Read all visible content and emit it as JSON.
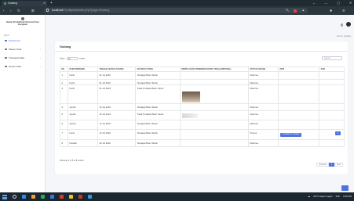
{
  "browser": {
    "tab_title": "Gudang",
    "new_tab_glyph": "+",
    "address_host": "localhost",
    "address_path": "/Ferdiipesa/index.php?page=Gudang",
    "window_controls": [
      "⌄",
      "—",
      "▢",
      "✕"
    ],
    "nav": [
      "‹",
      "›",
      "↻"
    ],
    "bookmark_glyph": "⊞"
  },
  "sidebar": {
    "brand_title": "Badan Pendaftaran Nasional Kota Bengkulu",
    "section_label": "MENU",
    "items": [
      {
        "label": "Dashboard",
        "icon": "dashboard-icon",
        "active": true
      },
      {
        "label": "Master Data",
        "icon": "folder-icon",
        "active": false,
        "chevron": "›"
      },
      {
        "label": "Transaksi Data",
        "icon": "exchange-icon",
        "active": false,
        "chevron": "›"
      },
      {
        "label": "Report Data",
        "icon": "report-icon",
        "active": false,
        "chevron": "›"
      }
    ]
  },
  "header": {
    "breadcrumb": "Home  /  Gudang"
  },
  "card": {
    "title": "Gudang",
    "show_label": "Show",
    "show_value": "10",
    "entries_label": "entries",
    "search_placeholder": "Search:",
    "columns": [
      "NO",
      "NAMA PEMOHON",
      "TANGGAL MASUK GUDANG",
      "CEK BUKU TANAH",
      "BERITA ACARA PENERIMAAN BUKU TANAH (OPTIONAL)",
      "STATUS GUDANG",
      "OPSI",
      "AKSI"
    ],
    "rows": [
      {
        "no": "1",
        "nama": "Farid",
        "tanggal": "01 Jul 2022",
        "cek": "Terdapat Buku Tanah",
        "status": "Diterima",
        "berita": "",
        "opsi": "",
        "aksi": ""
      },
      {
        "no": "2",
        "nama": "Farid",
        "tanggal": "01 Jul 2022",
        "cek": "Terdapat Buku Tanah",
        "status": "Diterima",
        "berita": "",
        "opsi": "",
        "aksi": ""
      },
      {
        "no": "3",
        "nama": "Farid",
        "tanggal": "01 Jul 2022",
        "cek": "Tidak Terdapat Buku Tanah",
        "status": "Diterima",
        "berita": "image",
        "opsi": "",
        "aksi": ""
      },
      {
        "no": "4",
        "nama": "Apriza",
        "tanggal": "10 Jul 2022",
        "cek": "Terdapat Buku Tanah",
        "status": "Diterima",
        "berita": "",
        "opsi": "",
        "aksi": ""
      },
      {
        "no": "5",
        "nama": "Apriza",
        "tanggal": "10 Jul 2022",
        "cek": "Tidak Terdapat Buku Tanah",
        "status": "Diterima",
        "berita": "doc",
        "opsi": "",
        "aksi": ""
      },
      {
        "no": "6",
        "nama": "Apriza",
        "tanggal": "10 Jul 2022",
        "cek": "Terdapat Buku Tanah",
        "status": "Diterima",
        "berita": "",
        "opsi": "",
        "aksi": ""
      },
      {
        "no": "7",
        "nama": "Farid",
        "tanggal": "13 Jul 2022",
        "cek": "Terdapat Buku Tanah",
        "status": "Proses",
        "berita": "",
        "opsi": "Lunaskan ke Gudang",
        "aksi": "✎"
      },
      {
        "no": "8",
        "nama": "Farsiah",
        "tanggal": "20 Jul 2022",
        "cek": "Terdapat Buku Tanah",
        "status": "Diterima",
        "berita": "",
        "opsi": "",
        "aksi": ""
      }
    ],
    "info_text": "Showing 1 to 8 of 8 entries",
    "pager": {
      "prev": "Previous",
      "page": "1",
      "next": "Next"
    }
  },
  "taskbar": {
    "weather": "32°C  Hujan ringan",
    "lang": "IND",
    "clock": "4:36 PM"
  },
  "colors": {
    "accent": "#4e73df",
    "sidebar_bg": "#ffffff",
    "taskbar_bg": "#1c2631"
  }
}
